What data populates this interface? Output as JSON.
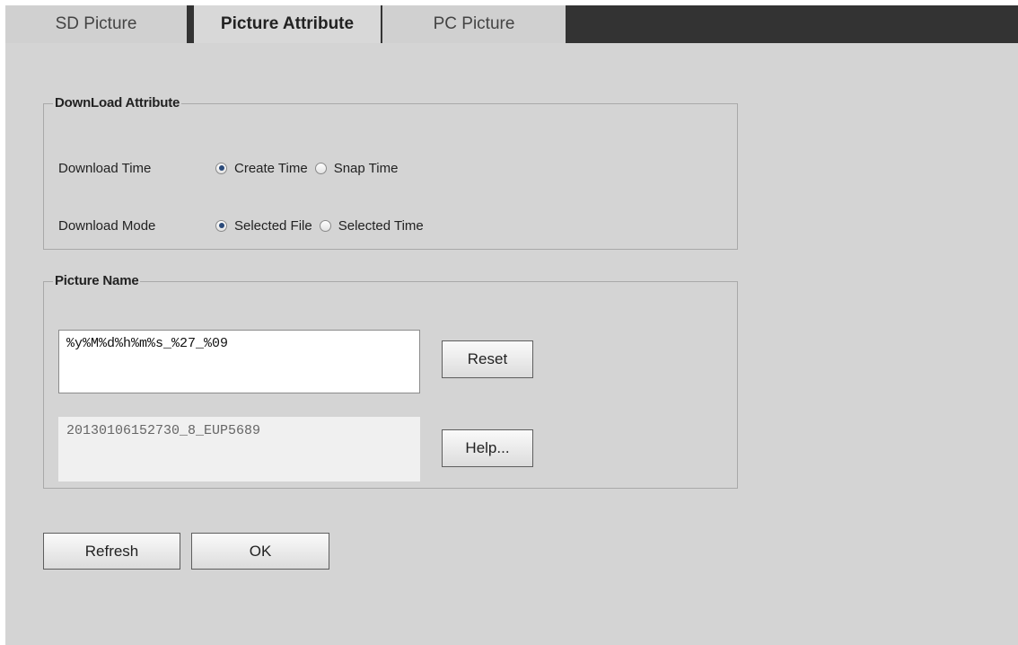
{
  "tabs": [
    {
      "label": "SD Picture"
    },
    {
      "label": "Picture Attribute"
    },
    {
      "label": "PC Picture"
    }
  ],
  "download_attribute": {
    "title": "DownLoad Attribute",
    "download_time": {
      "label": "Download Time",
      "options": [
        {
          "label": "Create Time",
          "selected": true
        },
        {
          "label": "Snap Time",
          "selected": false
        }
      ]
    },
    "download_mode": {
      "label": "Download Mode",
      "options": [
        {
          "label": "Selected File",
          "selected": true
        },
        {
          "label": "Selected Time",
          "selected": false
        }
      ]
    }
  },
  "picture_name": {
    "title": "Picture Name",
    "format_value": "%y%M%d%h%m%s_%27_%09",
    "preview_value": "20130106152730_8_EUP5689",
    "reset_label": "Reset",
    "help_label": "Help..."
  },
  "actions": {
    "refresh_label": "Refresh",
    "ok_label": "OK"
  }
}
